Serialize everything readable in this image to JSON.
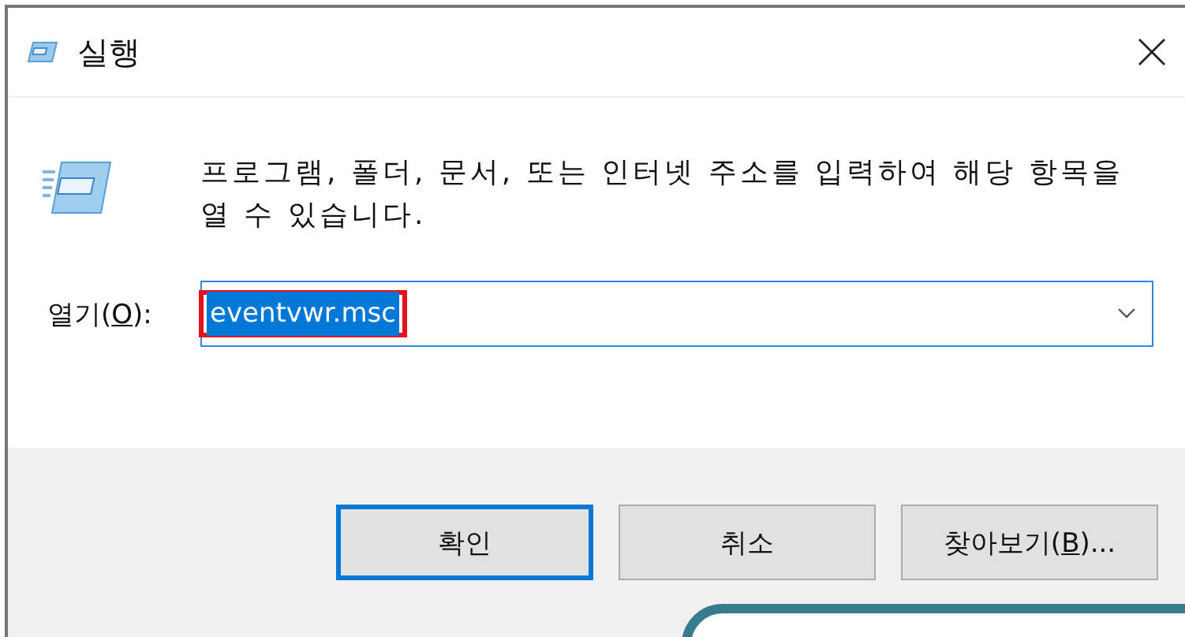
{
  "window": {
    "title": "실행"
  },
  "message": "프로그램, 폴더, 문서, 또는 인터넷 주소를 입력하여 해당 항목을 열 수 있습니다.",
  "open_field": {
    "label": {
      "before": "열기(",
      "key": "O",
      "after": "):"
    },
    "value": "eventvwr.msc",
    "value_selected": true,
    "highlighted": true
  },
  "buttons": [
    {
      "label": {
        "before": "확인"
      },
      "default": true
    },
    {
      "label": {
        "before": "취소"
      },
      "default": false
    },
    {
      "label": {
        "before": "찾아보기(",
        "key": "B",
        "after": ")..."
      },
      "default": false
    }
  ]
}
